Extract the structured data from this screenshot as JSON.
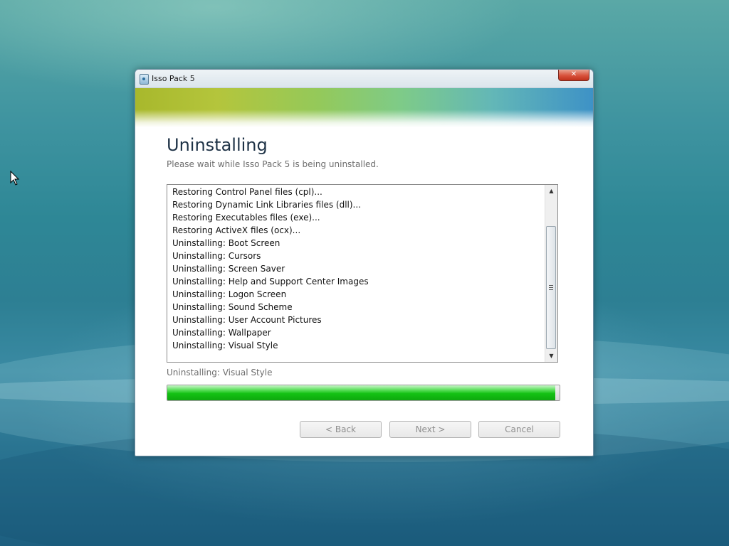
{
  "window": {
    "title": "Isso Pack 5",
    "close_label": "✕"
  },
  "header": {
    "heading": "Uninstalling",
    "subheading": "Please wait while Isso Pack 5 is being uninstalled."
  },
  "log": {
    "lines": [
      "Restoring Control Panel files (cpl)...",
      "Restoring Dynamic Link Libraries files (dll)...",
      "Restoring Executables files (exe)...",
      "Restoring ActiveX files (ocx)...",
      "Uninstalling: Boot Screen",
      "Uninstalling: Cursors",
      "Uninstalling: Screen Saver",
      "Uninstalling: Help and Support Center Images",
      "Uninstalling: Logon Screen",
      "Uninstalling: Sound Scheme",
      "Uninstalling: User Account Pictures",
      "Uninstalling: Wallpaper",
      "Uninstalling: Visual Style"
    ],
    "scroll_up_icon": "▲",
    "scroll_down_icon": "▼"
  },
  "status": {
    "text": "Uninstalling: Visual Style",
    "progress_percent": 99
  },
  "buttons": {
    "back": "< Back",
    "next": "Next >",
    "cancel": "Cancel"
  },
  "colors": {
    "progress_green": "#14c214",
    "heading_text": "#1e3246",
    "close_button_red": "#d8523c"
  }
}
